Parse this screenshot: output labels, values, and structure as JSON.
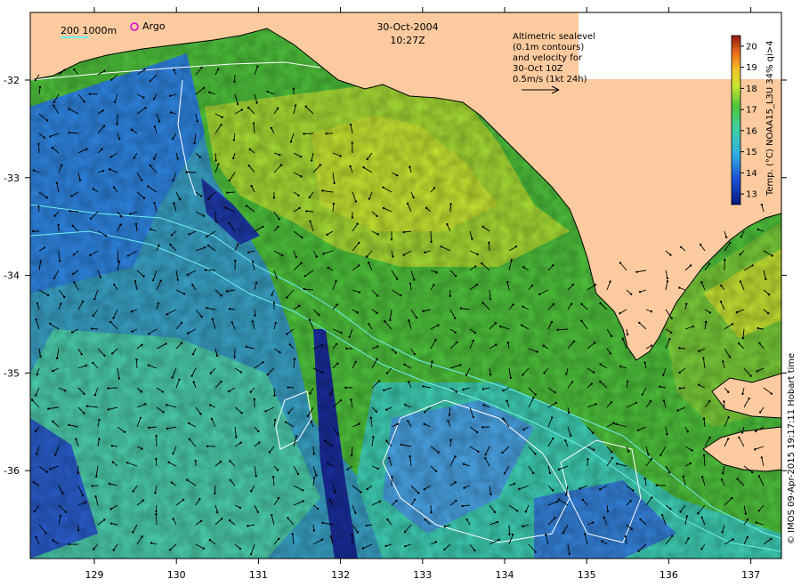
{
  "title": {
    "date": "30-Oct-2004",
    "time": "10:27Z"
  },
  "legend": {
    "isobath_label": "200 1000m",
    "argo_label": "Argo"
  },
  "velocity_note": {
    "lines": [
      "Altimetric sealevel",
      "(0.1m contours)",
      "and velocity for",
      "30-Oct 10Z",
      "0.5m/s (1kt 24h)"
    ]
  },
  "colorbar": {
    "title": "Temp. (°C) NOAA15_L3U 34% qi>4",
    "ticks": [
      "13",
      "14",
      "15",
      "16",
      "17",
      "18",
      "19",
      "20"
    ]
  },
  "credit": "© IMOS 09-Apr-2015 19:17:11 Hobart time",
  "axes": {
    "x_ticks": [
      "129",
      "130",
      "131",
      "132",
      "133",
      "134",
      "135",
      "136",
      "137"
    ],
    "y_ticks": [
      "-32",
      "-33",
      "-34",
      "-35",
      "-36"
    ]
  },
  "colors": {
    "land": "#fbcb9f",
    "ocean_green": "#49c23a",
    "ocean_yellow": "#c8e632",
    "ocean_blue": "#2f86e3",
    "ocean_cyan": "#3fd0b6",
    "ocean_deep": "#1a2d9c",
    "argo_marker": "#e000e0"
  }
}
